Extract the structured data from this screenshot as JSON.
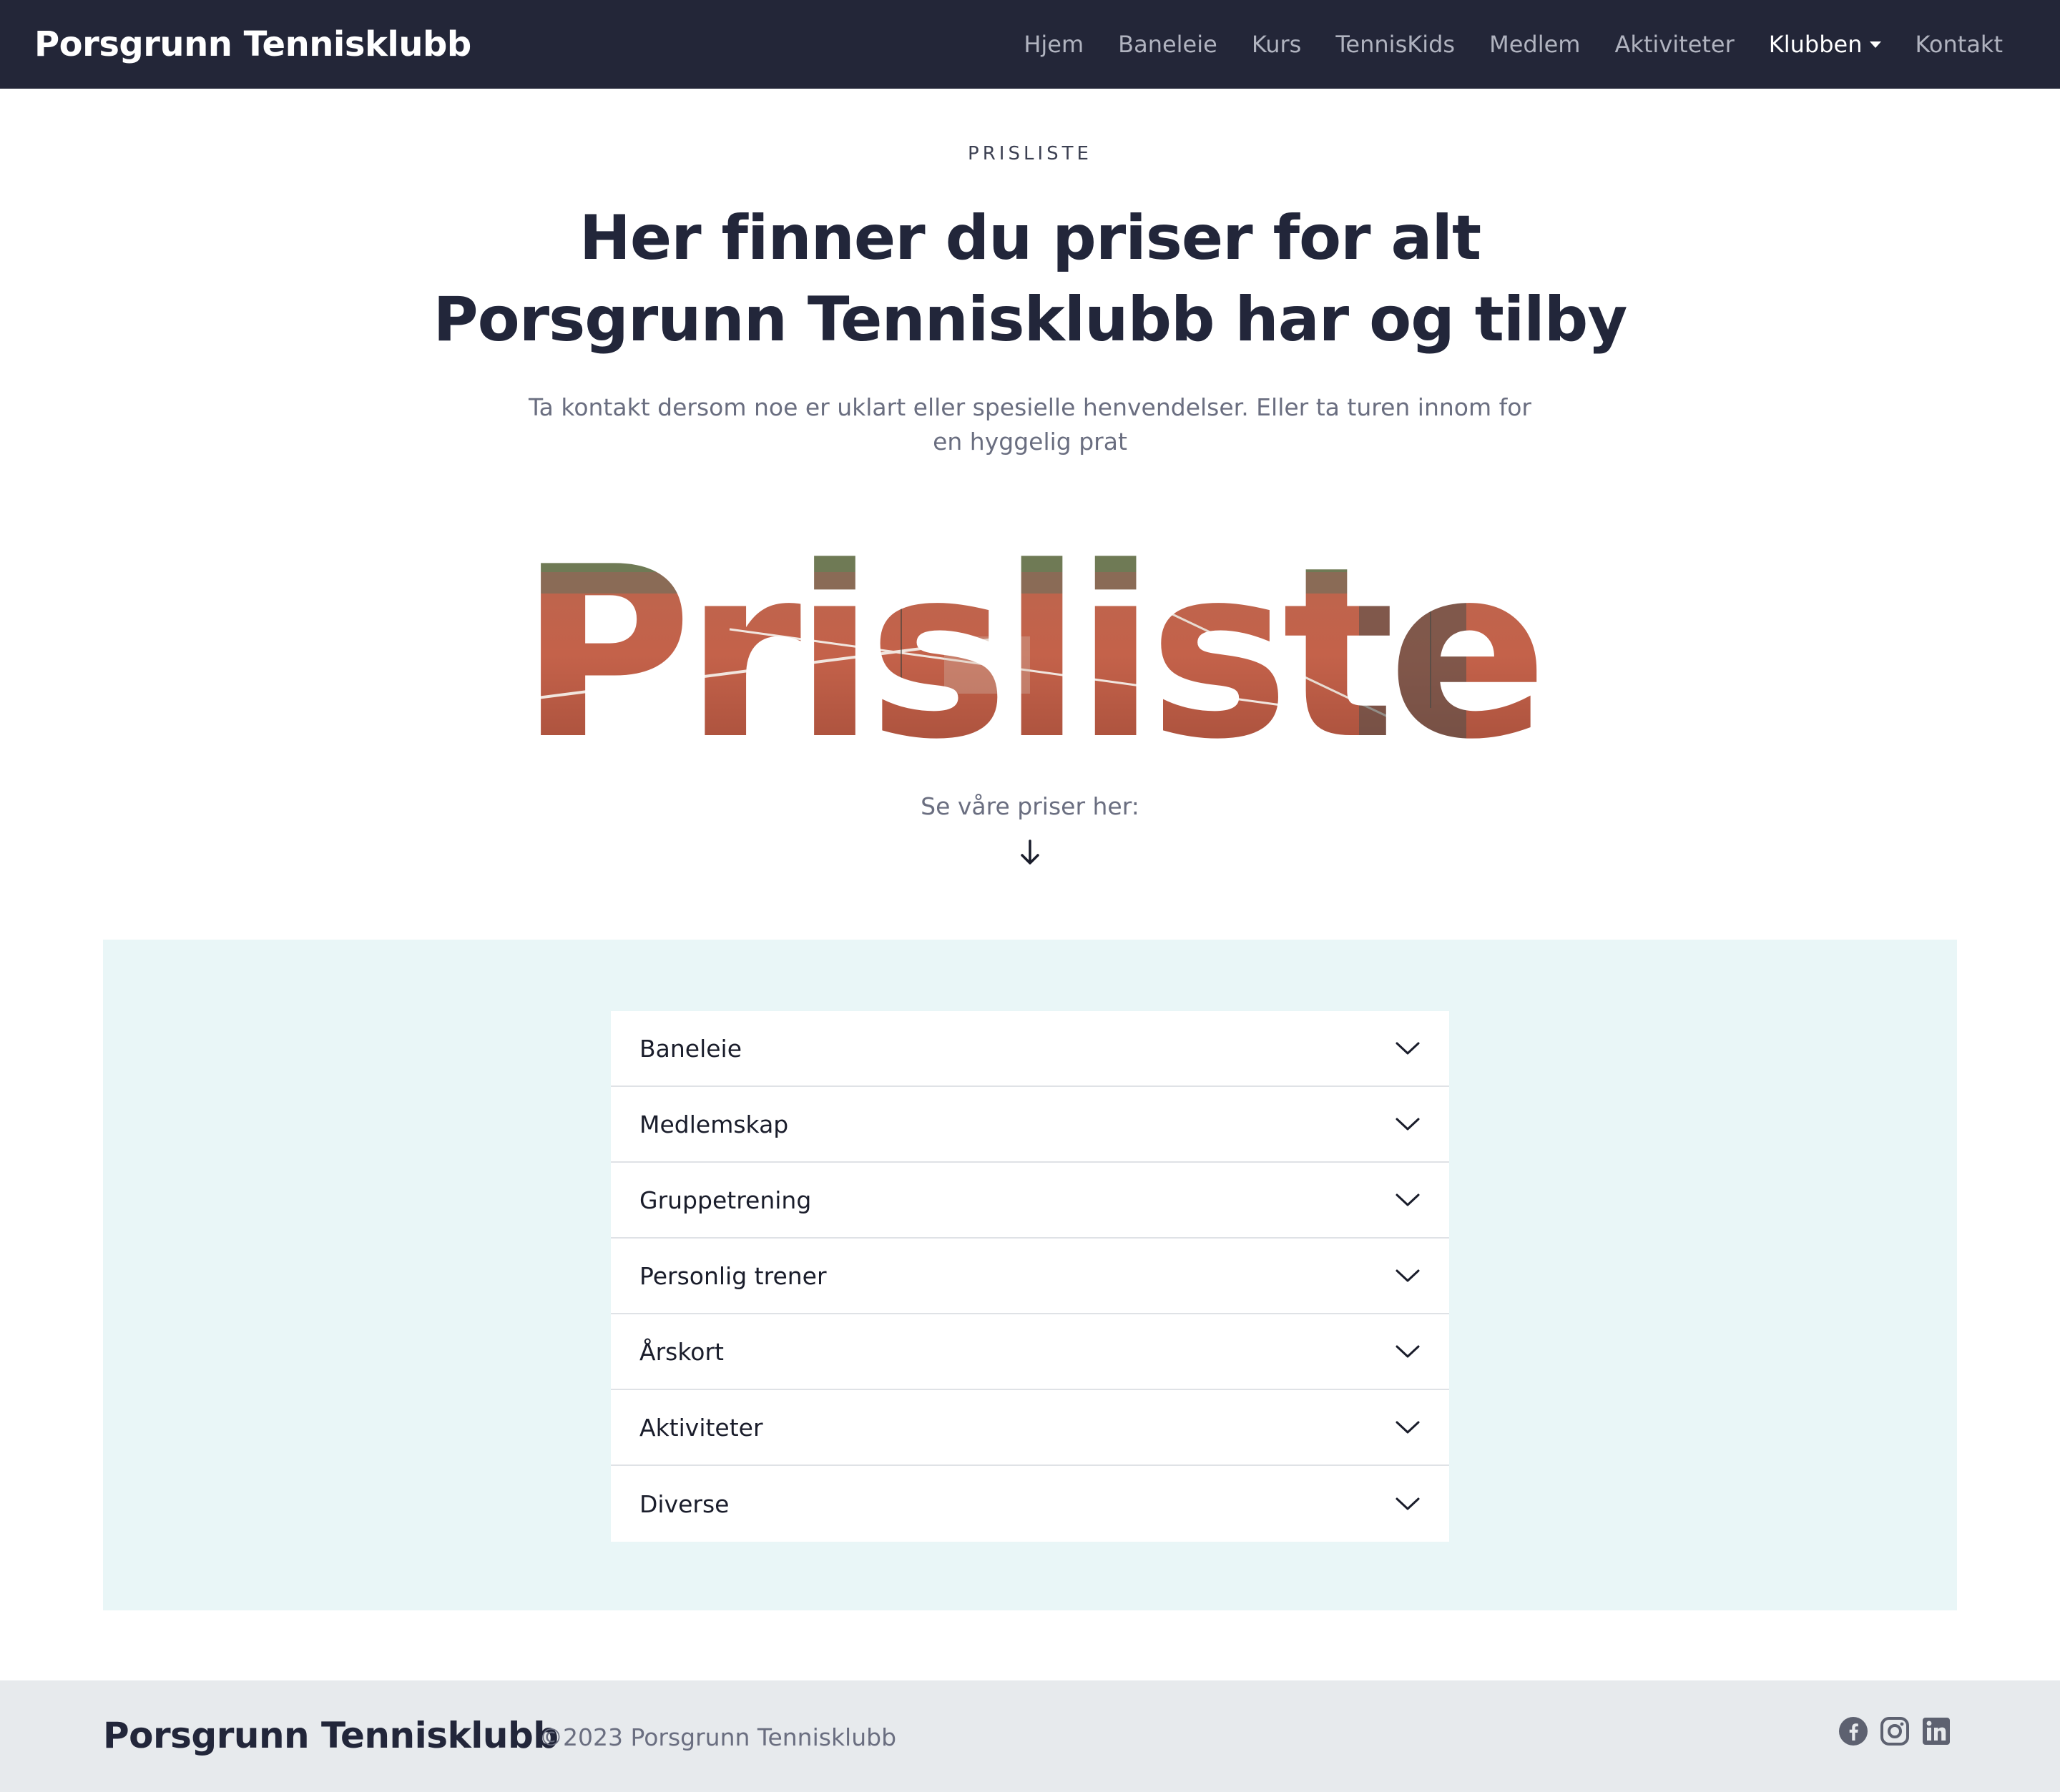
{
  "navbar": {
    "brand": "Porsgrunn Tennisklubb",
    "links": [
      "Hjem",
      "Baneleie",
      "Kurs",
      "TennisKids",
      "Medlem",
      "Aktiviteter",
      "Klubben",
      "Kontakt"
    ],
    "active": "Klubben"
  },
  "hero": {
    "eyebrow": "PRISLISTE",
    "headline_line1": "Her finner du priser for alt",
    "headline_line2": "Porsgrunn Tennisklubb har og tilby",
    "subtext": "Ta kontakt dersom noe er uklart eller spesielle henvendelser. Eller ta turen innom for en hyggelig prat",
    "image_word": "Prisliste",
    "see_prices": "Se våre priser her:"
  },
  "accordion": {
    "items": [
      "Baneleie",
      "Medlemskap",
      "Gruppetrening",
      "Personlig trener",
      "Årskort",
      "Aktiviteter",
      "Diverse"
    ]
  },
  "footer": {
    "brand": "Porsgrunn Tennisklubb",
    "copyright": "©2023 Porsgrunn Tennisklubb",
    "social_icons": [
      "facebook-icon",
      "instagram-icon",
      "linkedin-icon"
    ]
  },
  "colors": {
    "navbar_bg": "#232638",
    "section_bg": "#e9f6f7",
    "footer_bg": "#e7eaed",
    "court_clay": "#c0604a"
  }
}
